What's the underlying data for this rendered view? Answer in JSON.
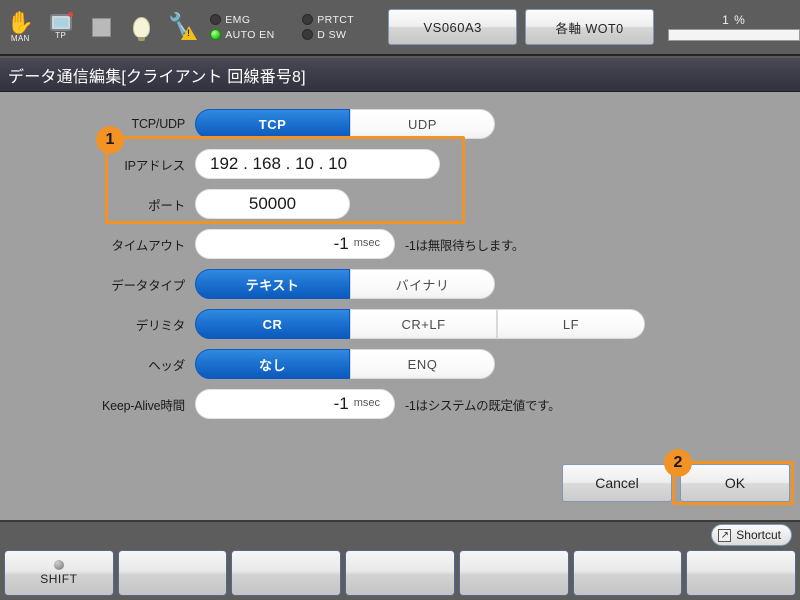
{
  "toolbar": {
    "icons": [
      {
        "name": "manual-mode-icon",
        "caption": "MAN"
      },
      {
        "name": "teach-pendant-icon",
        "caption": "TP"
      },
      {
        "name": "stop-square-icon",
        "caption": ""
      },
      {
        "name": "lamp-icon",
        "caption": ""
      },
      {
        "name": "maintenance-warning-icon",
        "caption": ""
      }
    ],
    "leds": [
      {
        "label": "EMG",
        "on": false
      },
      {
        "label": "PRTCT",
        "on": false
      },
      {
        "label": "AUTO EN",
        "on": true
      },
      {
        "label": "D SW",
        "on": false
      }
    ],
    "model_button": "VS060A3",
    "axis_button": "各軸 WOT0",
    "progress_label": "1 %",
    "progress_percent": 1
  },
  "window": {
    "title": "データ通信編集[クライアント 回線番号8]"
  },
  "form": {
    "protocol": {
      "label": "TCP/UDP",
      "options": [
        "TCP",
        "UDP"
      ],
      "selected": "TCP"
    },
    "ip_address": {
      "label": "IPアドレス",
      "value": "192 . 168 . 10 . 10"
    },
    "port": {
      "label": "ポート",
      "value": "50000"
    },
    "timeout": {
      "label": "タイムアウト",
      "value": "-1",
      "unit": "msec",
      "hint": "-1は無限待ちします。"
    },
    "data_type": {
      "label": "データタイプ",
      "options": [
        "テキスト",
        "バイナリ"
      ],
      "selected": "テキスト"
    },
    "delimiter": {
      "label": "デリミタ",
      "options": [
        "CR",
        "CR+LF",
        "LF"
      ],
      "selected": "CR"
    },
    "header": {
      "label": "ヘッダ",
      "options": [
        "なし",
        "ENQ"
      ],
      "selected": "なし"
    },
    "keep_alive": {
      "label": "Keep-Alive時間",
      "value": "-1",
      "unit": "msec",
      "hint": "-1はシステムの既定値です。"
    }
  },
  "annotations": [
    {
      "badge": "1",
      "target": "ip-port-group"
    },
    {
      "badge": "2",
      "target": "ok-button"
    }
  ],
  "dialog": {
    "cancel_label": "Cancel",
    "ok_label": "OK"
  },
  "shortcut": {
    "label": "Shortcut",
    "icon": "↗"
  },
  "function_keys": [
    {
      "label": "SHIFT",
      "has_indicator": true
    },
    {
      "label": "",
      "has_indicator": false
    },
    {
      "label": "",
      "has_indicator": false
    },
    {
      "label": "",
      "has_indicator": false
    },
    {
      "label": "",
      "has_indicator": false
    },
    {
      "label": "",
      "has_indicator": false
    },
    {
      "label": "",
      "has_indicator": false
    }
  ],
  "colors": {
    "accent_blue": "#0b59bd",
    "annotation_orange": "#f39325",
    "panel_gray": "#a0a0a0",
    "chrome_gray": "#5d5d5d",
    "led_green": "#3ddc2b"
  }
}
